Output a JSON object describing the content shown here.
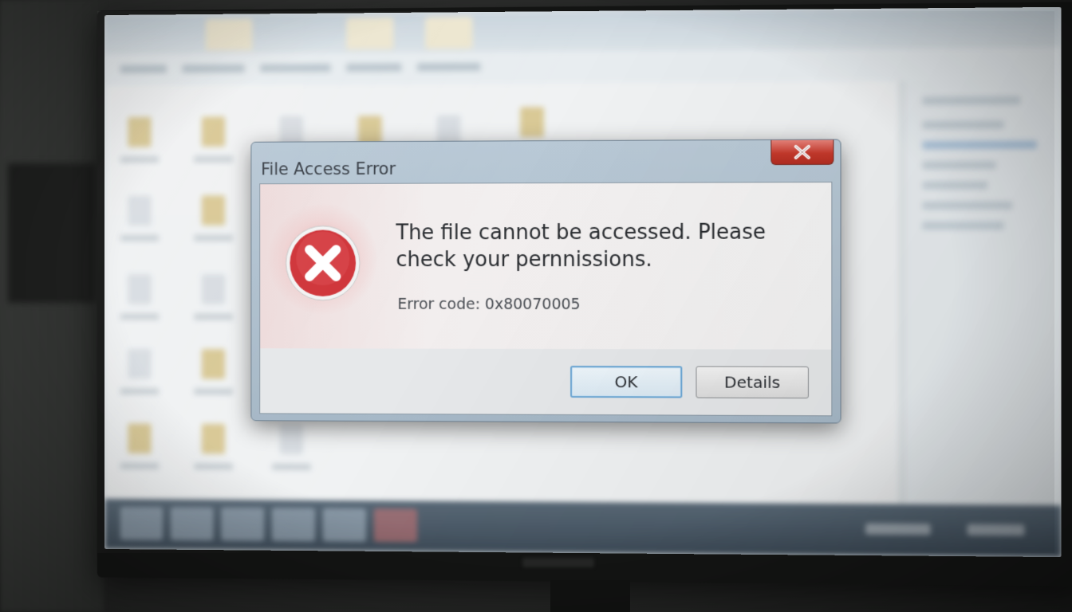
{
  "dialog": {
    "title": "File Access Error",
    "message": "The file cannot be accessed. Please check your pernnissions.",
    "error_code": "Error code: 0x80070005",
    "icon": "error-x-icon",
    "buttons": {
      "ok_label": "OK",
      "details_label": "Details"
    },
    "close_icon": "close-icon"
  },
  "colors": {
    "error_red": "#d0353a",
    "close_red": "#c5392c",
    "default_button_border": "#6fa9d6",
    "taskbar": "#4a5a68"
  }
}
